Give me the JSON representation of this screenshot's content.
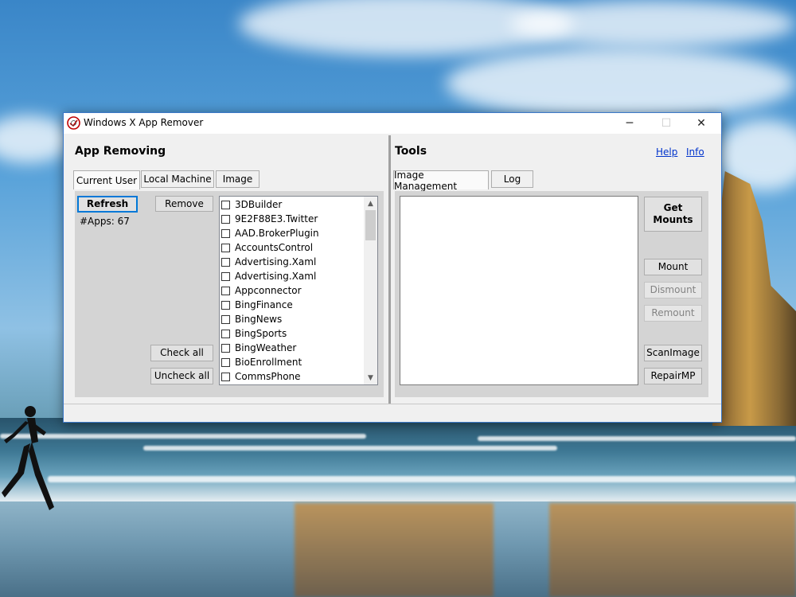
{
  "window": {
    "title": "Windows X App Remover",
    "controls": {
      "minimize": "─",
      "maximize": "☐",
      "close": "✕"
    }
  },
  "app_removing": {
    "title": "App Removing",
    "tabs": [
      {
        "label": "Current User",
        "active": true
      },
      {
        "label": "Local Machine",
        "active": false
      },
      {
        "label": "Image",
        "active": false
      }
    ],
    "refresh_label": "Refresh",
    "remove_label": "Remove",
    "app_count": "#Apps: 67",
    "check_all_label": "Check all",
    "uncheck_all_label": "Uncheck all",
    "apps": [
      {
        "name": "3DBuilder",
        "checked": false
      },
      {
        "name": "9E2F88E3.Twitter",
        "checked": false
      },
      {
        "name": "AAD.BrokerPlugin",
        "checked": false
      },
      {
        "name": "AccountsControl",
        "checked": false
      },
      {
        "name": "Advertising.Xaml",
        "checked": false
      },
      {
        "name": "Advertising.Xaml",
        "checked": false
      },
      {
        "name": "Appconnector",
        "checked": false
      },
      {
        "name": "BingFinance",
        "checked": false
      },
      {
        "name": "BingNews",
        "checked": false
      },
      {
        "name": "BingSports",
        "checked": false
      },
      {
        "name": "BingWeather",
        "checked": false
      },
      {
        "name": "BioEnrollment",
        "checked": false
      },
      {
        "name": "CommsPhone",
        "checked": false
      }
    ]
  },
  "tools": {
    "title": "Tools",
    "help_label": "Help",
    "info_label": "Info",
    "tabs": [
      {
        "label": "Image Management",
        "active": true
      },
      {
        "label": "Log",
        "active": false
      }
    ],
    "get_mounts_label": "Get Mounts",
    "mount_label": "Mount",
    "dismount_label": "Dismount",
    "remount_label": "Remount",
    "scan_image_label": "ScanImage",
    "repair_mp_label": "RepairMP"
  },
  "colors": {
    "accent": "#0078d7",
    "window_border": "#3c78c8",
    "link": "#0033cc",
    "panel": "#d4d4d4"
  }
}
